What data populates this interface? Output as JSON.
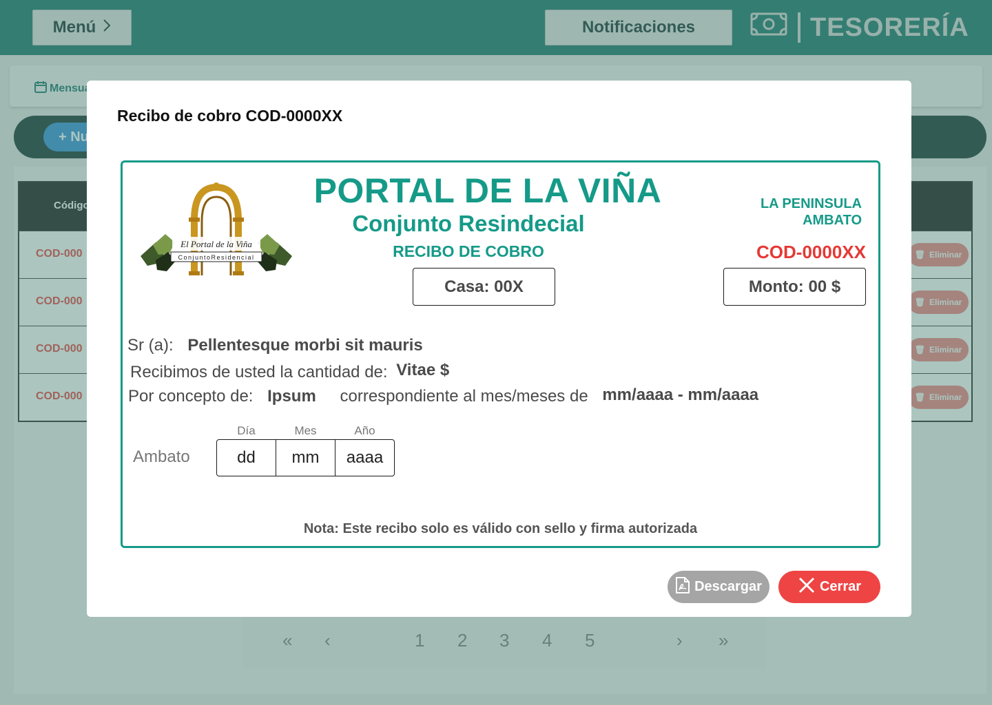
{
  "header": {
    "menu_label": "Menú",
    "notifications_label": "Notificaciones",
    "brand_label": "TESORERÍA"
  },
  "tabs": {
    "active_label": "Mensua"
  },
  "actions": {
    "new_label": "+ Nu"
  },
  "table": {
    "first_column": "Código",
    "rows": [
      {
        "code": "COD-000",
        "delete_label": "Eliminar"
      },
      {
        "code": "COD-000",
        "delete_label": "Eliminar"
      },
      {
        "code": "COD-000",
        "delete_label": "Eliminar"
      },
      {
        "code": "COD-000",
        "delete_label": "Eliminar"
      }
    ]
  },
  "pagination": {
    "pages": [
      "1",
      "2",
      "3",
      "4",
      "5"
    ]
  },
  "modal": {
    "title": "Recibo de cobro COD-0000XX",
    "receipt": {
      "org_name": "PORTAL DE LA VIÑA",
      "org_subtitle": "Conjunto Resindecial",
      "doc_type": "RECIBO DE COBRO",
      "location_line1": "LA PENINSULA",
      "location_line2": "AMBATO",
      "code": "COD-0000XX",
      "house": "Casa: 00X",
      "amount": "Monto: 00 $",
      "logo_text_1": "El Portal de la Viña",
      "logo_text_2": "ConjuntoResidencial",
      "recipient_label": "Sr (a):",
      "recipient_value": "Pellentesque morbi sit mauris",
      "amount_label": "Recibimos de usted la cantidad de:",
      "amount_value": "Vitae $",
      "concept_label": "Por concepto de:",
      "concept_value": "Ipsum",
      "period_label": "correspondiente al mes/meses de",
      "period_value": "mm/aaaa - mm/aaaa",
      "city": "Ambato",
      "date_headers": [
        "Día",
        "Mes",
        "Año"
      ],
      "date_values": [
        "dd",
        "mm",
        "aaaa"
      ],
      "note": "Nota: Este recibo solo es válido con sello y firma autorizada"
    },
    "download_label": "Descargar",
    "close_label": "Cerrar"
  },
  "colors": {
    "primary": "#0f6e64",
    "accent_teal": "#159a88",
    "danger": "#ef4444",
    "code_red": "#e53935",
    "disabled": "#a5a5a5"
  }
}
